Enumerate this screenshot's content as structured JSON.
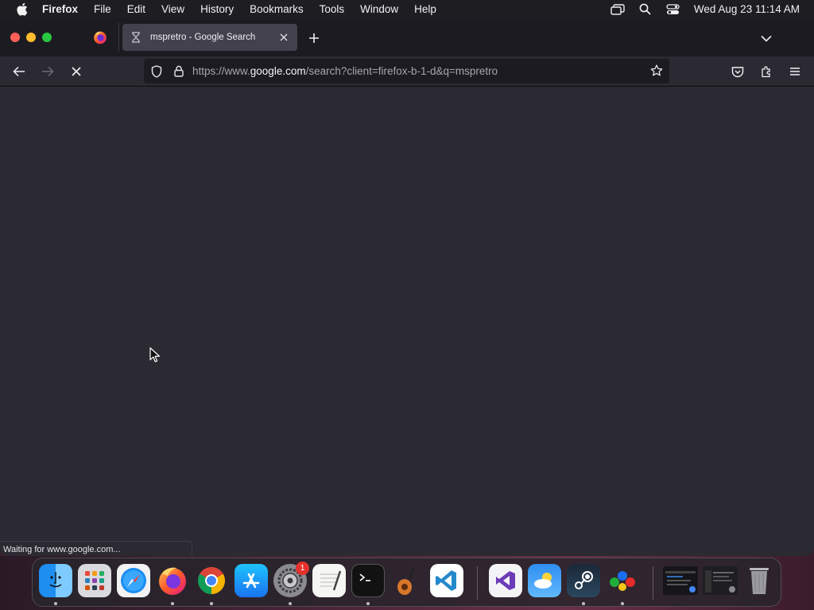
{
  "menubar": {
    "app_name": "Firefox",
    "items": [
      "File",
      "Edit",
      "View",
      "History",
      "Bookmarks",
      "Tools",
      "Window",
      "Help"
    ],
    "clock": "Wed Aug 23  11:14 AM"
  },
  "browser": {
    "tab": {
      "title": "mspretro - Google Search"
    },
    "url": {
      "prefix": "https://www.",
      "host": "google.com",
      "path": "/search?client=firefox-b-1-d&q=mspretro"
    },
    "status": "Waiting for www.google.com..."
  },
  "dock": {
    "badge_count": "1",
    "apps": [
      "Finder",
      "Launchpad",
      "Safari",
      "Firefox",
      "Chrome",
      "App Store",
      "System Settings",
      "TextEdit",
      "Terminal",
      "GarageBand",
      "Visual Studio Code",
      "Visual Studio",
      "Weather",
      "Steam",
      "Game Controller"
    ]
  },
  "colors": {
    "menubar_bg": "#1e1e22",
    "tabbar_bg": "#1c1b22",
    "content_bg": "#2b2a33",
    "active_tab_bg": "#42414d"
  }
}
